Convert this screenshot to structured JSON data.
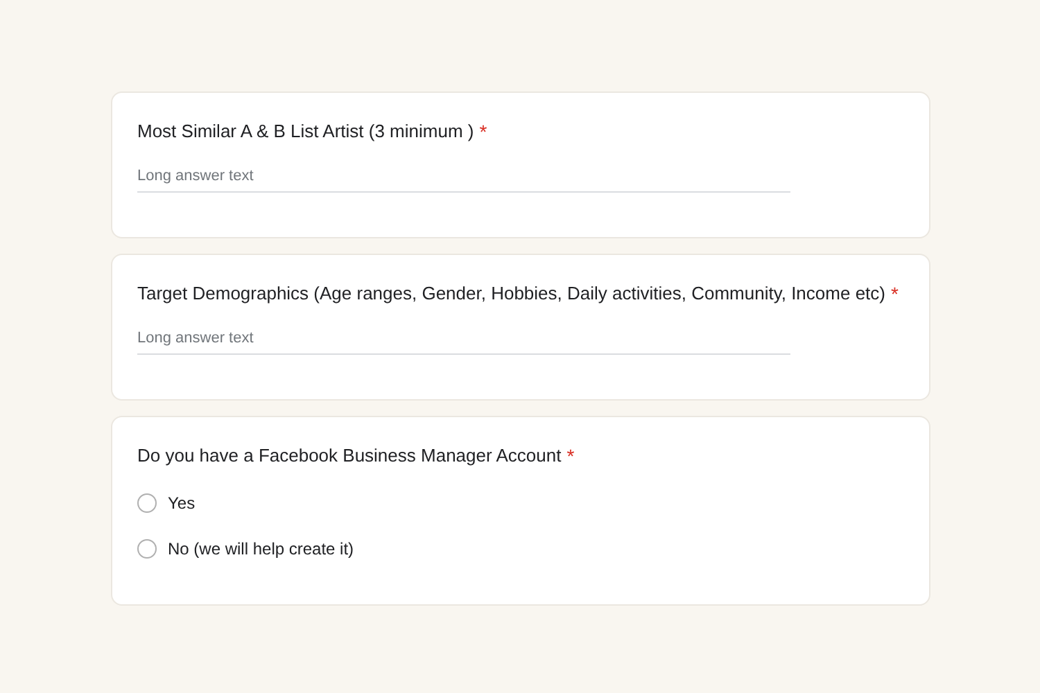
{
  "questions": [
    {
      "kind": "long_answer",
      "title": "Most Similar A & B List Artist (3 minimum )",
      "required_mark": "*",
      "placeholder": "Long answer text"
    },
    {
      "kind": "long_answer",
      "title": "Target Demographics (Age ranges, Gender, Hobbies, Daily activities, Community, Income etc)",
      "required_mark": "*",
      "placeholder": "Long answer text"
    },
    {
      "kind": "radio",
      "title": "Do you have a Facebook Business Manager Account",
      "required_mark": "*",
      "options": [
        {
          "label": "Yes",
          "selected": false
        },
        {
          "label": "No (we will help create it)",
          "selected": false
        }
      ]
    }
  ]
}
